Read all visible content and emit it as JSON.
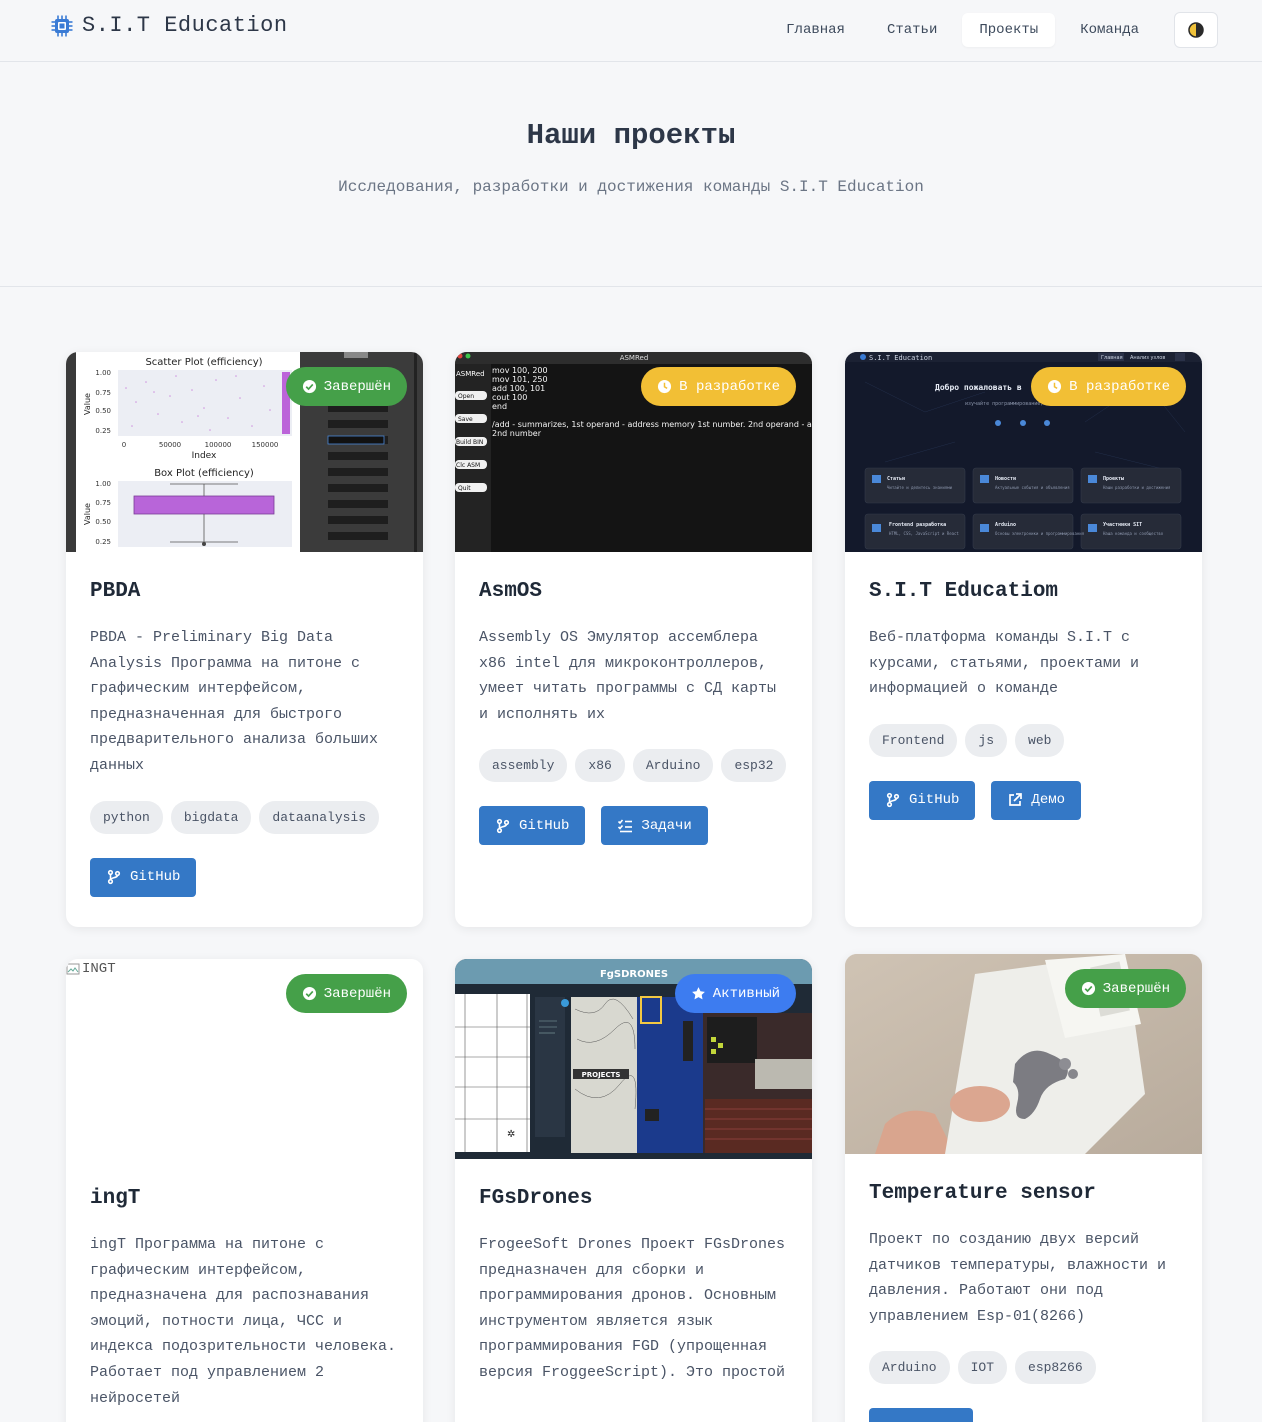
{
  "header": {
    "logo_text": "S.I.T Education",
    "nav": [
      "Главная",
      "Статьи",
      "Проекты",
      "Команда"
    ],
    "active_nav": "Проекты"
  },
  "hero": {
    "title": "Наши проекты",
    "subtitle": "Исследования, разработки и достижения команды S.I.T Education"
  },
  "projects": [
    {
      "title": "PBDA",
      "status": "Завершён",
      "description": "PBDA - Preliminary Big Data Analysis Программа на питоне с графическим интерфейсом, предназначенная для быстрого предварительного анализа больших данных",
      "tags": [
        "python",
        "bigdata",
        "dataanalysis"
      ],
      "buttons": [
        "GitHub"
      ],
      "screenshot": {
        "scatter_title": "Scatter Plot (efficiency)",
        "box_title": "Box Plot (efficiency)",
        "y_label": "Value",
        "x_label": "Index",
        "y_ticks": [
          "1.00",
          "0.75",
          "0.50",
          "0.25"
        ],
        "x_ticks": [
          "0",
          "50000",
          "100000",
          "150000"
        ]
      }
    },
    {
      "title": "AsmOS",
      "status": "В разработке",
      "description": "Assembly OS Эмулятор ассемблера x86 intel для микроконтроллеров, умеет читать программы с СД карты и исполнять их",
      "tags": [
        "assembly",
        "x86",
        "Arduino",
        "esp32"
      ],
      "buttons": [
        "GitHub",
        "Задачи"
      ],
      "screenshot": {
        "window_title": "ASMRed",
        "side_title": "ASMRed",
        "side_buttons": [
          "Open",
          "Save",
          "Build BIN",
          "Clc ASM",
          "Quit"
        ],
        "code": [
          "mov 100, 200",
          "mov 101, 250",
          "add 100, 101",
          "cout 100",
          "end"
        ],
        "comment": [
          "/add - summarizes, 1st operand - address memory 1st number. 2nd operand - address memory",
          "2nd number"
        ]
      }
    },
    {
      "title": "S.I.T Educatiom",
      "status": "В разработке",
      "description": "Веб-платформа команды S.I.T с курсами, статьями, проектами и информацией о команде",
      "tags": [
        "Frontend",
        "js",
        "web"
      ],
      "buttons": [
        "GitHub",
        "Демо"
      ],
      "screenshot": {
        "logo": "S.I.T Education",
        "nav": [
          "Главная",
          "Анализ узлов"
        ],
        "heading": "Добро пожаловать в",
        "subheading": "изучайте программирование, электронику",
        "tiles": [
          "Статьи",
          "Новости",
          "Проекты",
          "Frontend разработка",
          "Arduino",
          "Участники SIT"
        ],
        "tile_notes": [
          "Читайте и делитесь знаниями",
          "Актуальные события и объявления",
          "Наши разработки и достижения",
          "HTML, CSS, JavaScript и React",
          "Основы электроники и программирования",
          "Наша команда и сообщество"
        ]
      }
    },
    {
      "title": "ingT",
      "status": "Завершён",
      "image_alt": "INGT",
      "description": "ingT Программа на питоне с графическим интерфейсом, предназначена для распознавания эмоций, потности лица, ЧСС и индекса подозрительности человека. Работает под управлением 2 нейросетей",
      "tags": [],
      "buttons": []
    },
    {
      "title": "FGsDrones",
      "status": "Активный",
      "description": "FrogeeSoft Drones Проект FGsDrones предназначен для сборки и программирования дронов. Основным инструментом является язык программирования FGD (упрощенная версия FroggeeScript). Это простой",
      "tags": [],
      "buttons": [],
      "screenshot": {
        "banner": "FgSDRONES",
        "sticker": "PROJECTS"
      }
    },
    {
      "title": "Temperature sensor",
      "status": "Завершён",
      "description": "Проект по созданию двух версий датчиков температуры, влажности и давления. Работают они под управлением Esp-01(8266)",
      "tags": [
        "Arduino",
        "IOT",
        "esp8266"
      ],
      "buttons": []
    }
  ],
  "colors": {
    "accent": "#3478c6",
    "status_done": "#45a049",
    "status_dev": "#f2bf35",
    "status_active": "#3d7cf0"
  }
}
